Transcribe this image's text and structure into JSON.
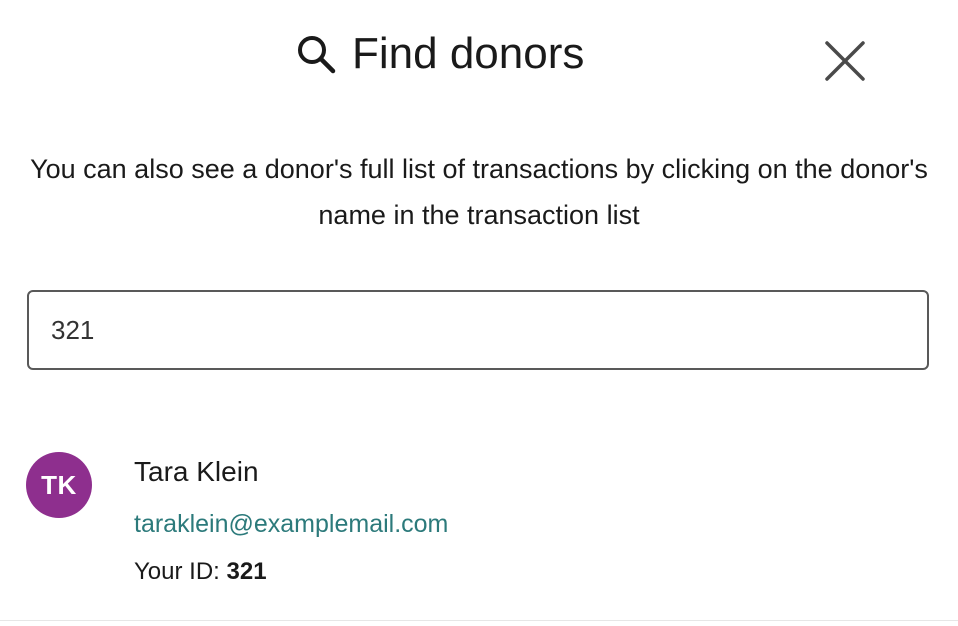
{
  "header": {
    "title": "Find donors",
    "search_icon": "search-icon",
    "close_icon": "close-icon"
  },
  "description": "You can also see a donor's full list of transactions by clicking on the donor's name in the transaction list",
  "search": {
    "value": "321",
    "placeholder": ""
  },
  "results": [
    {
      "initials": "TK",
      "name": "Tara Klein",
      "email": "taraklein@examplemail.com",
      "id_label": "Your ID:",
      "id_value": "321",
      "avatar_color": "#8e2f8e"
    }
  ],
  "colors": {
    "email_link": "#2c7a7b",
    "input_border": "#595959",
    "text": "#1a1a1a"
  }
}
